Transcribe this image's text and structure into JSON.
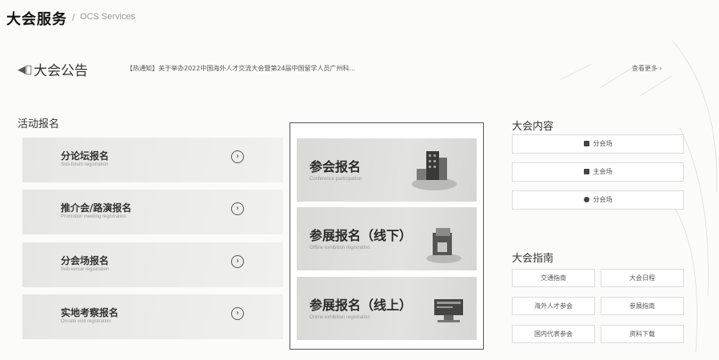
{
  "header": {
    "title": "大会服务",
    "separator": "/",
    "subtitle": "OCS Services"
  },
  "notice": {
    "speaker_icon": "speaker-icon",
    "title": "大会公告",
    "text": "【热通知】关于举办2022中国海外人才交流大会暨第24届中国留学人员广州科...",
    "more": "查看更多 ›"
  },
  "activity": {
    "heading": "活动报名",
    "cards": [
      {
        "title": "分论坛报名",
        "subtitle": "Sub-forum registration"
      },
      {
        "title": "推介会/路演报名",
        "subtitle": "Promotion meeting registration"
      },
      {
        "title": "分会场报名",
        "subtitle": "Sub-venue registration"
      },
      {
        "title": "实地考察报名",
        "subtitle": "On-site visit registration"
      }
    ],
    "arrow": "›"
  },
  "registration": [
    {
      "title": "参会报名",
      "subtitle": "Conference participation",
      "icon": "building-icon"
    },
    {
      "title": "参展报名（线下）",
      "subtitle": "Offline exhibition registration",
      "icon": "booth-icon"
    },
    {
      "title": "参展报名（线上）",
      "subtitle": "Online exhibition registration",
      "icon": "monitor-icon"
    }
  ],
  "content": {
    "heading": "大会内容",
    "items": [
      {
        "label": "分会场",
        "icon": "chat-icon"
      },
      {
        "label": "主会场",
        "icon": "document-icon"
      },
      {
        "label": "分会场",
        "icon": "globe-icon"
      }
    ]
  },
  "guide": {
    "heading": "大会指南",
    "items": [
      "交通指南",
      "大会日程",
      "海外人才参会",
      "参展指南",
      "国内代表参会",
      "资料下载"
    ]
  },
  "colors": {
    "text": "#222222",
    "card": "#e6e6e3",
    "border": "#555555"
  }
}
